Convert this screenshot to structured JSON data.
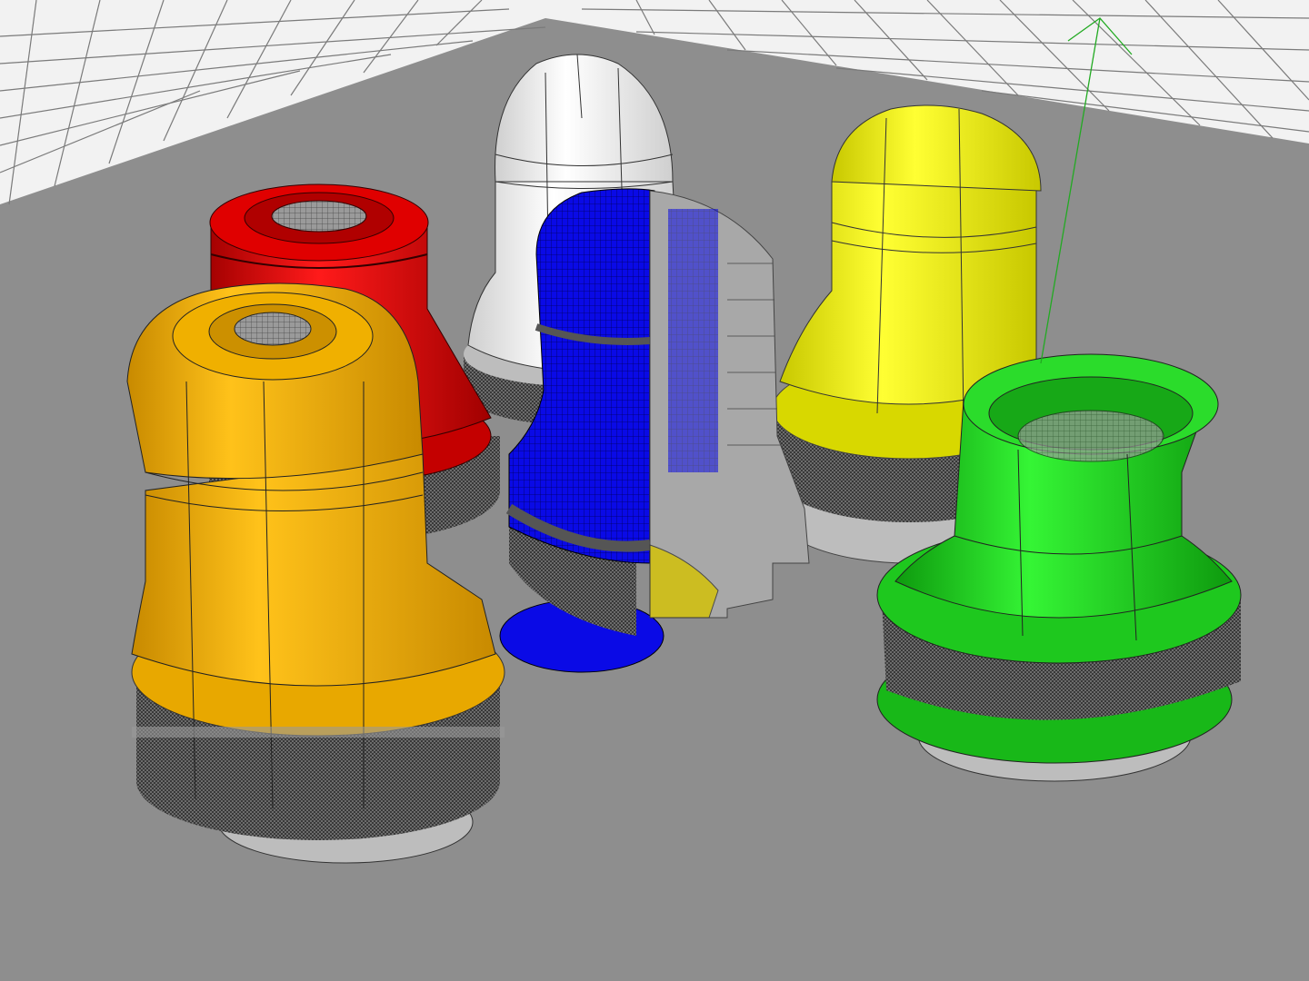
{
  "viewport": {
    "view": "perspective",
    "background_color": "#8e8e8e",
    "grid": true,
    "grid_color": "#ffffff",
    "grid_line_color": "#7a7a7a",
    "selection_axis_color": "#22aa22"
  },
  "objects": [
    {
      "name": "red-part",
      "color": "#d80000",
      "state": "shaded"
    },
    {
      "name": "white-part",
      "color": "#f2f2f2",
      "state": "shaded"
    },
    {
      "name": "yellow-part",
      "color": "#e6e600",
      "state": "shaded"
    },
    {
      "name": "orange-part",
      "color": "#e8a800",
      "state": "shaded"
    },
    {
      "name": "blue-part",
      "color": "#0a0ae6",
      "state": "cutaway section"
    },
    {
      "name": "green-part",
      "color": "#1ec81e",
      "state": "selected"
    }
  ]
}
